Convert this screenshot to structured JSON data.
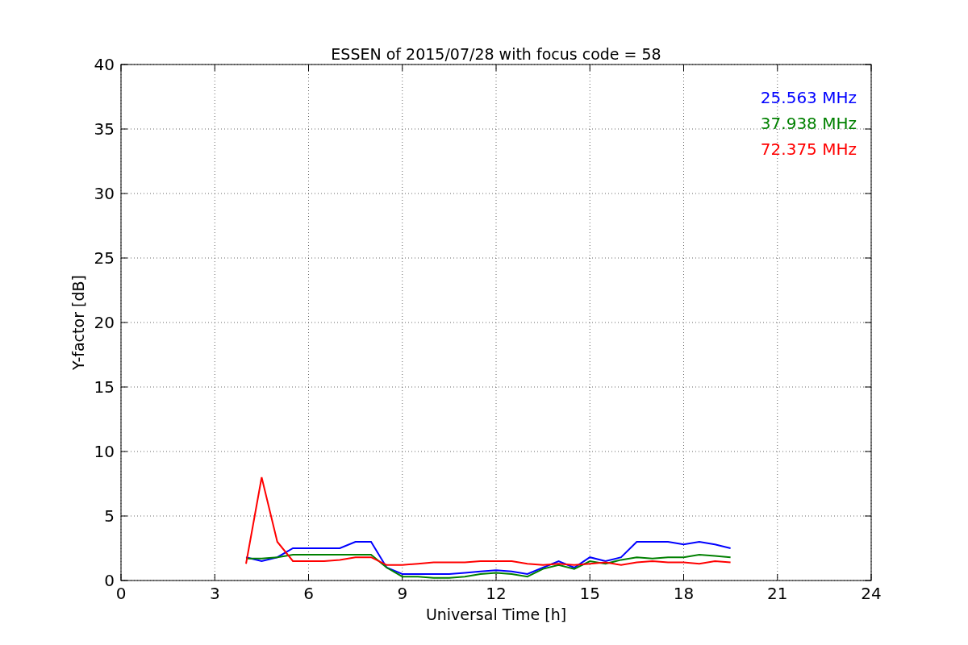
{
  "chart_data": {
    "type": "line",
    "title": "ESSEN of 2015/07/28 with focus code = 58",
    "xlabel": "Universal Time [h]",
    "ylabel": "Y-factor [dB]",
    "x": [
      4,
      4.5,
      5,
      5.5,
      6,
      6.5,
      7,
      7.5,
      8,
      8.5,
      9,
      9.5,
      10,
      10.5,
      11,
      11.5,
      12,
      12.5,
      13,
      13.5,
      14,
      14.5,
      15,
      15.5,
      16,
      16.5,
      17,
      17.5,
      18,
      18.5,
      19,
      19.5
    ],
    "series": [
      {
        "name": "25.563 MHz",
        "color": "#0000ff",
        "values": [
          1.8,
          1.5,
          1.8,
          2.5,
          2.5,
          2.5,
          2.5,
          3,
          3,
          1,
          0.5,
          0.5,
          0.5,
          0.5,
          0.6,
          0.7,
          0.8,
          0.7,
          0.5,
          1,
          1.5,
          1,
          1.8,
          1.5,
          1.8,
          3,
          3,
          3,
          2.8,
          3,
          2.8,
          2.5
        ]
      },
      {
        "name": "37.938 MHz",
        "color": "#008000",
        "values": [
          1.7,
          1.7,
          1.8,
          2,
          2,
          2,
          2,
          2,
          2,
          1,
          0.3,
          0.3,
          0.2,
          0.2,
          0.3,
          0.5,
          0.6,
          0.5,
          0.3,
          0.9,
          1.2,
          0.9,
          1.5,
          1.3,
          1.6,
          1.8,
          1.7,
          1.8,
          1.8,
          2,
          1.9,
          1.8
        ]
      },
      {
        "name": "72.375 MHz",
        "color": "#ff0000",
        "values": [
          1.3,
          8,
          3,
          1.5,
          1.5,
          1.5,
          1.6,
          1.8,
          1.8,
          1.2,
          1.2,
          1.3,
          1.4,
          1.4,
          1.4,
          1.5,
          1.5,
          1.5,
          1.3,
          1.2,
          1.3,
          1.2,
          1.3,
          1.4,
          1.2,
          1.4,
          1.5,
          1.4,
          1.4,
          1.3,
          1.5,
          1.4
        ]
      }
    ],
    "xlim": [
      0,
      24
    ],
    "ylim": [
      0,
      40
    ],
    "xticks": [
      0,
      3,
      6,
      9,
      12,
      15,
      18,
      21,
      24
    ],
    "yticks": [
      0,
      5,
      10,
      15,
      20,
      25,
      30,
      35,
      40
    ],
    "grid": true
  }
}
